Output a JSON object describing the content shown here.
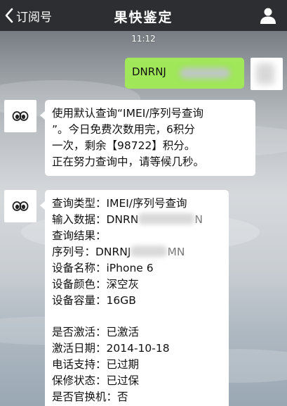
{
  "header": {
    "back_label": "订阅号",
    "title": "果快鉴定"
  },
  "timestamp": "11:12",
  "user_message": {
    "visible_text": "DNRNJ"
  },
  "bot_message_1": {
    "lines": [
      "使用默认查询“IMEI/序列号查询",
      "”。今日免费次数用完，6积分",
      "一次，剩余【98722】积分。",
      "正在努力查询中，请等候几秒。"
    ]
  },
  "bot_message_2": {
    "query_type": "查询类型：IMEI/序列号查询",
    "input_label": "输入数据：DNRN",
    "input_tail": "N",
    "result_label": "查询结果：",
    "serial_label": "序列号：DNRNJ",
    "serial_tail": "MN",
    "device_name": "设备名称：iPhone 6",
    "device_color": "设备颜色：深空灰",
    "device_capacity": "设备容量：16GB",
    "activated": "是否激活：已激活",
    "activation_date": "激活日期：2014-10-18",
    "phone_support": "电话支持：已过期",
    "warranty": "保修状态：已过保",
    "replacement": "是否官换机：否"
  },
  "colors": {
    "topbar": "#2d2e32",
    "user_bubble": "#a0e759",
    "bot_bubble": "#ffffff"
  },
  "icons": {
    "back": "chevron-left-icon",
    "profile": "person-icon",
    "bot_avatar": "eyes-icon"
  }
}
